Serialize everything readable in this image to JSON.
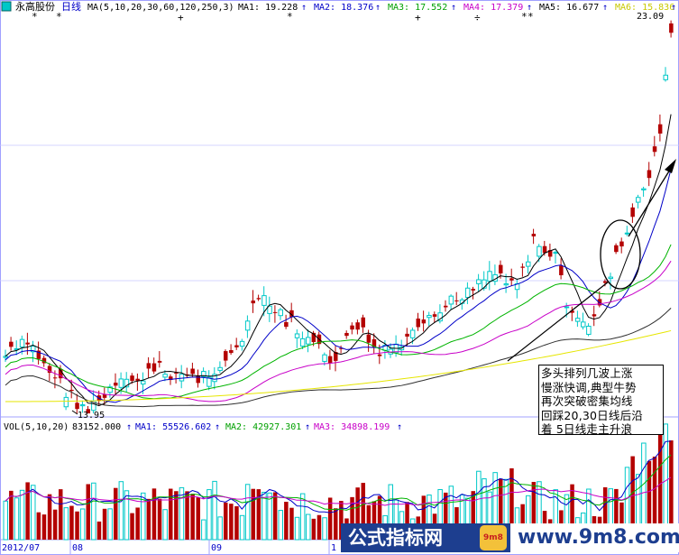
{
  "header": {
    "icon": "stock-icon",
    "stock_name": "永高股份",
    "period": "日线",
    "ma_params": "MA(5,10,20,30,60,120,250,3)",
    "ma_items": [
      {
        "label": "MA1: 19.228",
        "color": "#000000"
      },
      {
        "label": "MA2: 18.376",
        "color": "#0000c8"
      },
      {
        "label": "MA3: 17.552",
        "color": "#00a000"
      },
      {
        "label": "MA4: 17.379",
        "color": "#c800c8"
      },
      {
        "label": "MA5: 16.677",
        "color": "#000000"
      },
      {
        "label": "MA6: 15.836",
        "color": "#c8c800"
      }
    ]
  },
  "volume_header": {
    "params": "VOL(5,10,20)",
    "value": "83152.000",
    "items": [
      {
        "label": "MA1: 55526.602",
        "color": "#0000c8"
      },
      {
        "label": "MA2: 42927.301",
        "color": "#00a000"
      },
      {
        "label": "MA3: 34898.199",
        "color": "#c800c8"
      }
    ]
  },
  "price_labels": {
    "high": "23.09",
    "low": "13.95"
  },
  "annotation": {
    "lines": [
      "多头排列几波上涨",
      "慢涨快调,典型牛势",
      "再次突破密集均线",
      "回踩20,30日线后沿",
      "着 5日线走主升浪"
    ]
  },
  "x_axis_labels": [
    "2012/07",
    "08",
    "09",
    "1"
  ],
  "watermark": {
    "left": "公式指标网",
    "right": "www.9m8.com",
    "logo": "9m8"
  },
  "colors": {
    "up": "#00c8c8",
    "down": "#b40000",
    "ma5": "#000000",
    "ma10": "#0000c8",
    "ma20": "#00b400",
    "ma30": "#c800c8",
    "ma60": "#303030",
    "ma120": "#e6e600",
    "border": "#a0a0ff"
  },
  "chart_data": {
    "type": "candlestick",
    "title": "永高股份 日线",
    "price_axis_range": [
      13.0,
      23.5
    ],
    "highest_label": 23.09,
    "lowest_label": 13.95,
    "moving_averages": {
      "MA5": 19.228,
      "MA10": 18.376,
      "MA20": 17.552,
      "MA30": 17.379,
      "MA60": 16.677,
      "MA120": 15.836
    },
    "volume": {
      "VOL": 83152.0,
      "MA5": 55526.602,
      "MA10": 42927.301,
      "MA20": 34898.199
    },
    "x_labels": [
      "2012/07",
      "08",
      "09",
      "1"
    ]
  }
}
